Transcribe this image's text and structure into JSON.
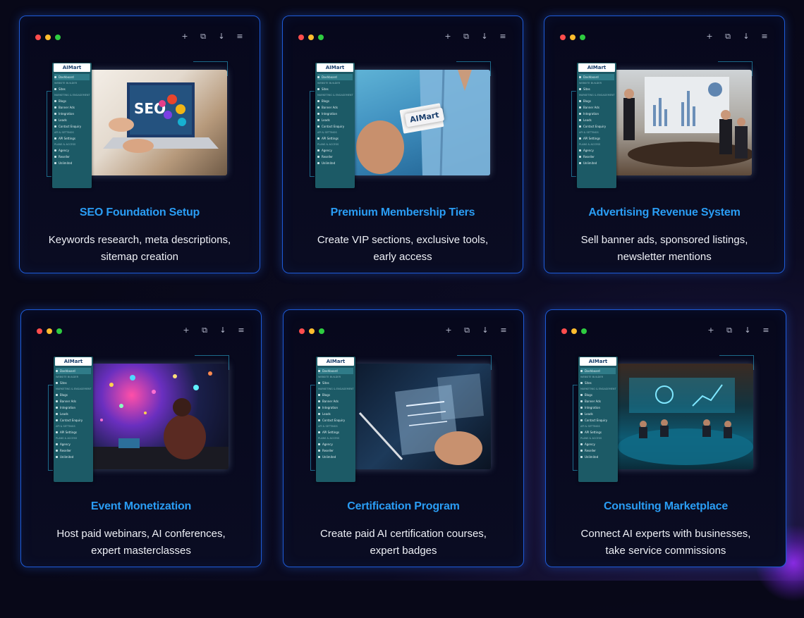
{
  "window_tools": [
    "+",
    "⧉",
    "↓",
    "≡"
  ],
  "sidebar": {
    "logo": "AIMart",
    "items": [
      "Dashboard",
      "WEBSITE BUILDER",
      "Sites",
      "MARKETING & ENGAGEMENT",
      "Blogs",
      "Banner Ads",
      "Integration",
      "Leads",
      "Contact Enquiry",
      "API & SETTINGS",
      "API Settings",
      "PLANS & ACCESS",
      "Agency",
      "Reseller",
      "Unlimited"
    ]
  },
  "cards": [
    {
      "title": "SEO Foundation Setup",
      "desc1": "Keywords research, meta descriptions,",
      "desc2": "sitemap creation",
      "photo": "laptop-seo"
    },
    {
      "title": "Premium Membership Tiers",
      "desc1": "Create VIP sections, exclusive tools,",
      "desc2": "early access",
      "photo": "business-card",
      "photo_text": "AIMart"
    },
    {
      "title": "Advertising Revenue System",
      "desc1": "Sell banner ads, sponsored listings,",
      "desc2": "newsletter mentions",
      "photo": "boardroom-presentation"
    },
    {
      "title": "Event Monetization",
      "desc1": "Host paid webinars, AI conferences,",
      "desc2": "expert masterclasses",
      "photo": "neon-event"
    },
    {
      "title": "Certification Program",
      "desc1": "Create paid AI certification courses,",
      "desc2": "expert badges",
      "photo": "holographic-certificate"
    },
    {
      "title": "Consulting Marketplace",
      "desc1": "Connect AI experts with businesses,",
      "desc2": "take service commissions",
      "photo": "ai-meeting-room"
    }
  ],
  "colors": {
    "title": "#2a9df4",
    "border": "#1e5bd8",
    "sidebar": "#1c5a66"
  }
}
